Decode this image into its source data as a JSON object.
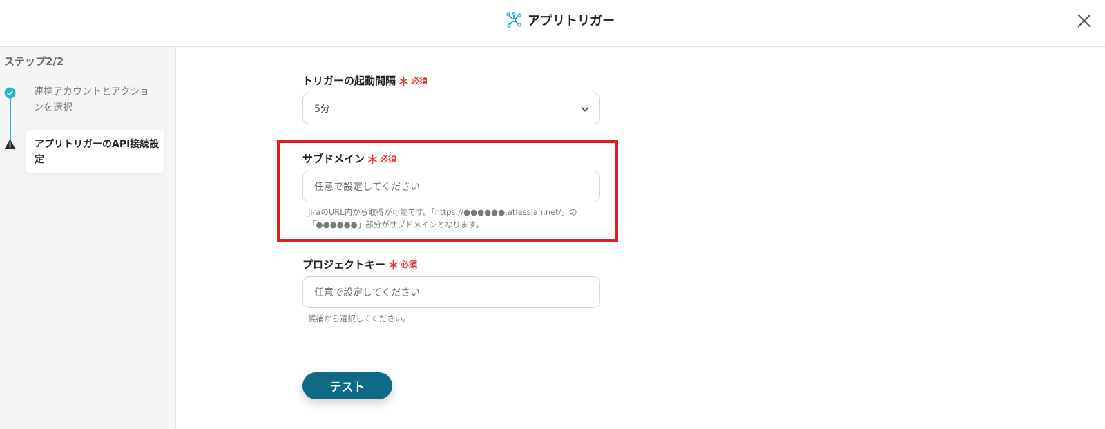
{
  "header": {
    "title": "アプリトリガー",
    "logo_icon": "network-nodes-icon",
    "close_icon": "close-icon"
  },
  "sidebar": {
    "step_count": "ステップ2/2",
    "steps": [
      {
        "label": "連携アカウントとアクションを選択",
        "status": "complete",
        "icon": "check-circle-icon"
      },
      {
        "label": "アプリトリガーのAPI接続設定",
        "status": "warning",
        "icon": "warning-triangle-icon"
      }
    ]
  },
  "form": {
    "required_mark": "＊",
    "required_text": "必須",
    "interval": {
      "label": "トリガーの起動間隔",
      "value": "5分"
    },
    "subdomain": {
      "label": "サブドメイン",
      "placeholder": "任意で設定してください",
      "help_line1": "JiraのURL内から取得が可能です。「https://●●●●●●.atlassian.net/」の",
      "help_line2": "「●●●●●●」部分がサブドメインとなります。"
    },
    "project_key": {
      "label": "プロジェクトキー",
      "placeholder": "任意で設定してください",
      "help": "候補から選択してください。"
    },
    "test_button": "テスト"
  },
  "colors": {
    "accent": "#0f6b85",
    "step_line": "#1fb8cf",
    "required": "#e23b3b",
    "highlight": "#e21f1f"
  }
}
